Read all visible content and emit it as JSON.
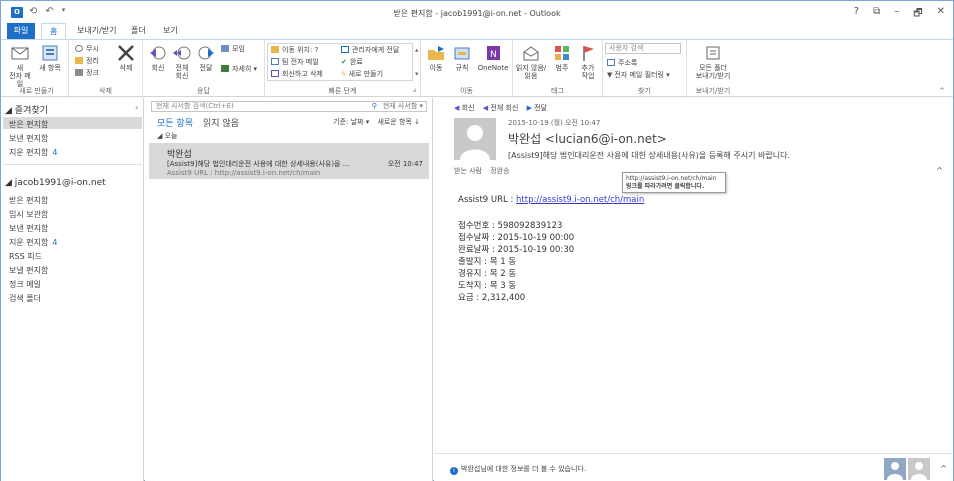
{
  "window": {
    "title": "받은 편지함 - jacob1991@i-on.net - Outlook",
    "app_icon": "O",
    "controls": [
      "?",
      "⧉",
      "–",
      "🗗",
      "✕"
    ]
  },
  "ribbon_tabs": [
    "파일",
    "홈",
    "보내기/받기",
    "폴더",
    "보기"
  ],
  "ribbon": {
    "new": {
      "new_email": "새\n전자 메일",
      "new_items": "새 항목",
      "label": "새로 만들기"
    },
    "delete": {
      "ignore": "무시",
      "cleanup": "정리",
      "junk": "정크",
      "delete": "삭제",
      "label": "삭제"
    },
    "respond": {
      "reply": "회신",
      "reply_all": "전체\n회신",
      "forward": "전달",
      "meeting": "모임",
      "more": "자세히",
      "label": "응답"
    },
    "quick_steps": {
      "move_to": "이동 위치: ?",
      "team_email": "팀 전자 메일",
      "reply_delete": "회신하고 삭제",
      "to_manager": "관리자에게 전달",
      "done": "완료",
      "create_new": "새로 만들기",
      "label": "빠른 단계"
    },
    "move": {
      "move": "이동",
      "rules": "규칙",
      "onenote": "OneNote",
      "label": "이동"
    },
    "tags": {
      "unread_read": "읽지 않음/\n읽음",
      "categorize": "범주",
      "follow_up": "추가\n작업",
      "label": "태그"
    },
    "find": {
      "search_people_placeholder": "사용자 검색",
      "address_book": "주소록",
      "filter_email": "전자 메일 필터링",
      "label": "찾기"
    },
    "send_receive": {
      "all_folders": "모든 폴더\n보내기/받기",
      "label": "보내기/받기"
    }
  },
  "folder_pane": {
    "favorites_header": "즐겨찾기",
    "favorites": [
      {
        "name": "받은 편지함",
        "count": ""
      },
      {
        "name": "보낸 편지함",
        "count": ""
      },
      {
        "name": "지운 편지함",
        "count": "4"
      }
    ],
    "account": "jacob1991@i-on.net",
    "folders": [
      {
        "name": "받은 편지함",
        "count": ""
      },
      {
        "name": "임시 보관함",
        "count": ""
      },
      {
        "name": "보낸 편지함",
        "count": ""
      },
      {
        "name": "지운 편지함",
        "count": "4"
      },
      {
        "name": "RSS 피드",
        "count": ""
      },
      {
        "name": "보낼 편지함",
        "count": ""
      },
      {
        "name": "정크 메일",
        "count": ""
      },
      {
        "name": "검색 폴더",
        "count": ""
      }
    ]
  },
  "message_list": {
    "search_placeholder": "현재 사서함 검색(Ctrl+E)",
    "search_scope": "현재 사서함 ▾",
    "filter_all": "모든 항목",
    "filter_unread": "읽지 않음",
    "sort_by": "기준: 날짜 ▾",
    "sort_order": "새로운 항목 ↓",
    "group_label": "◢ 오늘",
    "items": [
      {
        "sender": "박완섭",
        "subject": "[Assist9]해당 법인대리운전 사용에 대한 상세내용(사유)을 ...",
        "time": "오전 10:47",
        "preview": "Assist9 URL : http://assist9.i-on.net/ch/main"
      }
    ]
  },
  "reading_pane": {
    "actions": [
      "회신",
      "전체 회신",
      "전달"
    ],
    "date": "2015-10-19 (월) 오전 10:47",
    "from": "박완섭 <lucian6@i-on.net>",
    "subject": "[Assist9]해당 법인대리운전 사용에 대한 상세내용(사유)을 등록해 주시기 바랍니다.",
    "to_label": "받는 사람",
    "to_name": "정완승",
    "tooltip_url": "http://assist9.i-on.net/ch/main",
    "tooltip_hint": "링크를 따라가려면 클릭합니다.",
    "body": {
      "url_label": "Assist9 URL : ",
      "url": "http://assist9.i-on.net/ch/main",
      "lines": [
        "접수번호 : 598092839123",
        "접수날짜 : 2015-10-19 00:00",
        "완료날짜 : 2015-10-19 00:30",
        "출발지 : 목 1 동",
        "경유지 : 목 2 동",
        "도착지 : 목 3 동",
        "요금 : 2,312,400"
      ]
    },
    "people_pane_text": "박완섭님에 대한 정보를 더 볼 수 있습니다."
  }
}
